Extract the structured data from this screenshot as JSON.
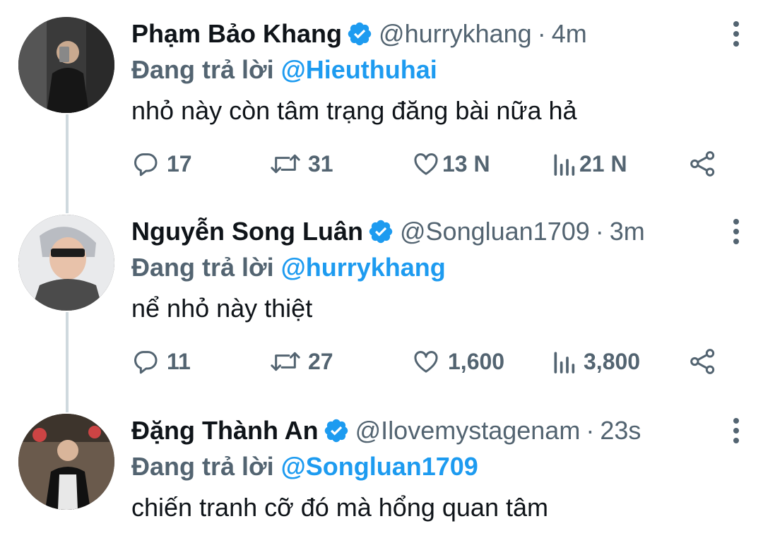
{
  "colors": {
    "link": "#1d9bf0",
    "secondary": "#536471",
    "primary": "#0f1419",
    "thread_line": "#cfd9de"
  },
  "icons": {
    "verified": "verified-badge-icon",
    "more": "more-vertical-icon",
    "reply": "reply-icon",
    "retweet": "retweet-icon",
    "like": "heart-icon",
    "views": "analytics-icon",
    "share": "share-icon"
  },
  "tweets": [
    {
      "name": "Phạm Bảo Khang",
      "handle": "@hurrykhang",
      "separator": "·",
      "time": "4m",
      "reply_label": "Đang trả lời",
      "reply_to": "@Hieuthuhai",
      "text": "nhỏ này còn tâm trạng đăng bài nữa hả",
      "replies": "17",
      "retweets": "31",
      "likes": "13 N",
      "views": "21 N"
    },
    {
      "name": "Nguyễn Song Luân",
      "handle": "@Songluan1709",
      "separator": "·",
      "time": "3m",
      "reply_label": "Đang trả lời",
      "reply_to": "@hurrykhang",
      "text": "nể nhỏ này thiệt",
      "replies": "11",
      "retweets": "27",
      "likes": "1,600",
      "views": "3,800"
    },
    {
      "name": "Đặng Thành An",
      "handle": "@Ilovemystagenam",
      "separator": "·",
      "time": "23s",
      "reply_label": "Đang trả lời",
      "reply_to": "@Songluan1709",
      "text": "chiến tranh cỡ đó mà hổng quan tâm"
    }
  ]
}
